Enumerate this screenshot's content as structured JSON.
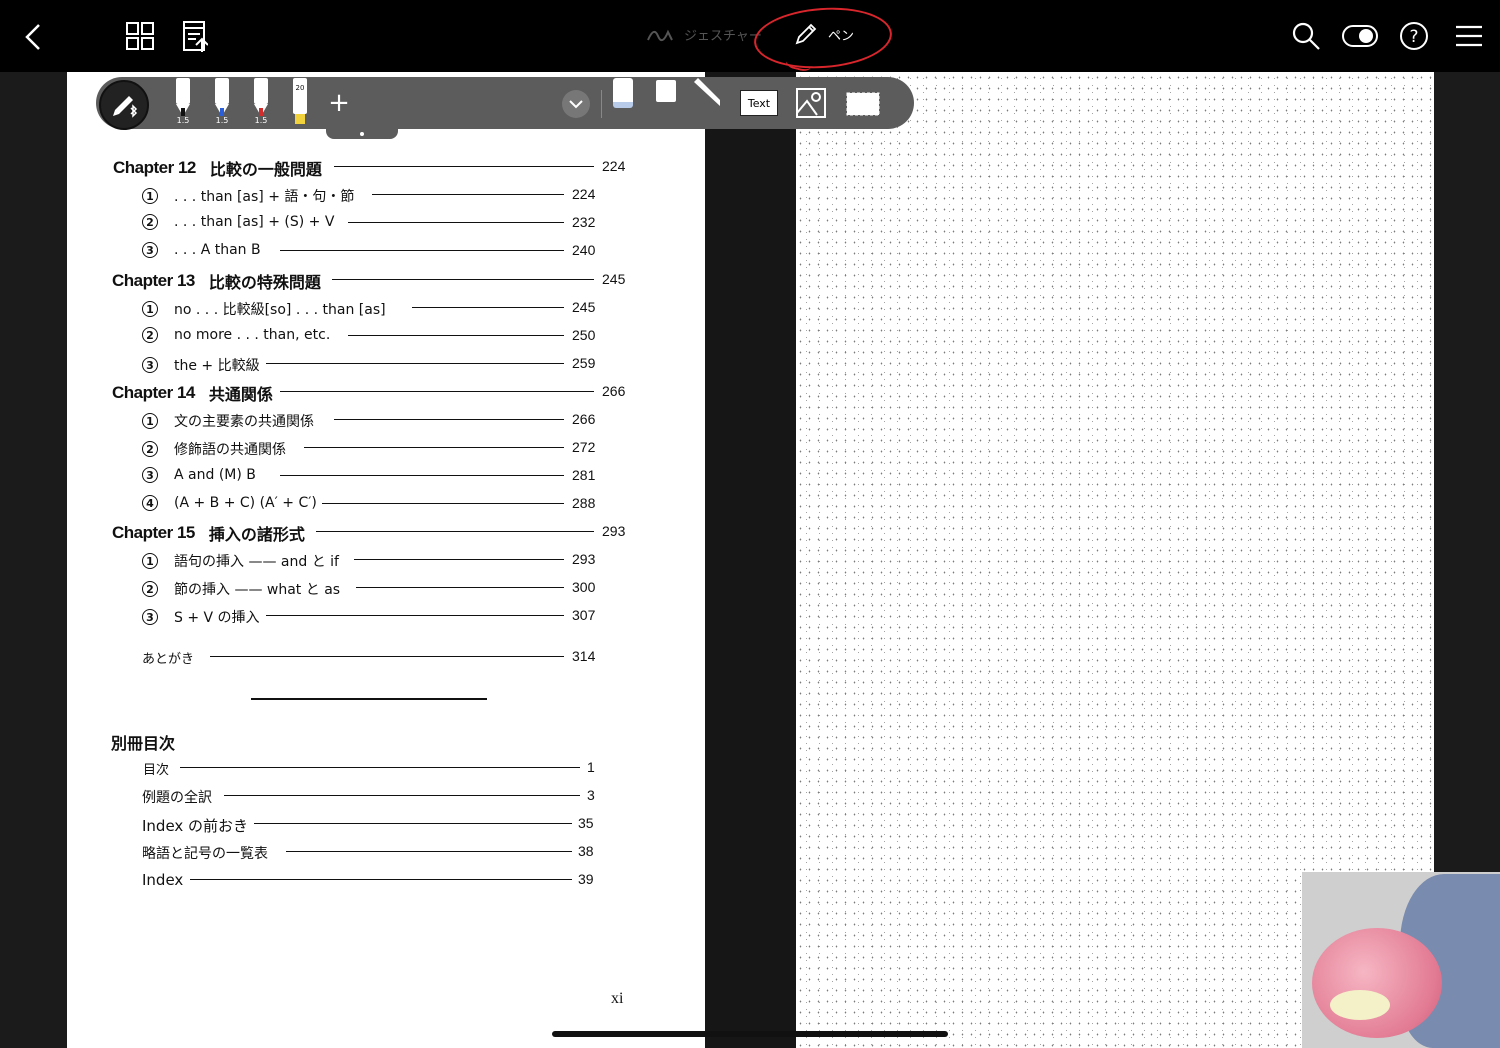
{
  "topbar": {
    "back_icon": "chevron-left-icon",
    "grid_icon": "grid-icon",
    "export_icon": "export-icon",
    "modes": {
      "gesture": "ジェスチャー",
      "pen": "ペン"
    },
    "right_icons": [
      "search-icon",
      "toggle-icon",
      "help-icon",
      "menu-icon"
    ],
    "help_glyph": "?"
  },
  "toolbar": {
    "tools": [
      {
        "name": "pen-tool-black",
        "color": "#111111",
        "size": "1.5"
      },
      {
        "name": "pen-tool-blue",
        "color": "#2b5fd9",
        "size": "1.5"
      },
      {
        "name": "pen-tool-red",
        "color": "#d42b2b",
        "size": "1.5"
      },
      {
        "name": "highlighter-yellow",
        "color": "#f2d23c",
        "size": "20"
      }
    ],
    "add_glyph": "+",
    "text_tool_label": "Text"
  },
  "toc": {
    "chapters": [
      {
        "number": "Chapter 12",
        "title": "比較の一般問題",
        "page": "224",
        "sections": [
          {
            "num": "1",
            "title": ". . . than [as] + 語・句・節",
            "page": "224"
          },
          {
            "num": "2",
            "title": ". . . than [as] + (S) + V",
            "page": "232"
          },
          {
            "num": "3",
            "title": ". . . A than B",
            "page": "240"
          }
        ]
      },
      {
        "number": "Chapter 13",
        "title": "比較の特殊問題",
        "page": "245",
        "sections": [
          {
            "num": "1",
            "title": "no . . . 比較級[so] . . . than [as]",
            "page": "245"
          },
          {
            "num": "2",
            "title": "no more . . . than, etc.",
            "page": "250"
          },
          {
            "num": "3",
            "title": "the + 比較級",
            "page": "259"
          }
        ]
      },
      {
        "number": "Chapter 14",
        "title": "共通関係",
        "page": "266",
        "sections": [
          {
            "num": "1",
            "title": "文の主要素の共通関係",
            "page": "266"
          },
          {
            "num": "2",
            "title": "修飾語の共通関係",
            "page": "272"
          },
          {
            "num": "3",
            "title": "A and (M) B",
            "page": "281"
          },
          {
            "num": "4",
            "title": "(A + B + C) (A′ + C′)",
            "page": "288"
          }
        ]
      },
      {
        "number": "Chapter 15",
        "title": "挿入の諸形式",
        "page": "293",
        "sections": [
          {
            "num": "1",
            "title": "語句の挿入 —— and と if",
            "page": "293"
          },
          {
            "num": "2",
            "title": "節の挿入 —— what と as",
            "page": "300"
          },
          {
            "num": "3",
            "title": "S + V の挿入",
            "page": "307"
          }
        ]
      }
    ],
    "afterword": {
      "title": "あとがき",
      "page": "314"
    },
    "bessatsu_heading": "別冊目次",
    "bessatsu": [
      {
        "title": "目次",
        "page": "1"
      },
      {
        "title": "例題の全訳",
        "page": "3"
      },
      {
        "title": "Index の前おき",
        "page": "35"
      },
      {
        "title": "略語と記号の一覧表",
        "page": "38"
      },
      {
        "title": "Index",
        "page": "39"
      }
    ],
    "folio": "xi"
  },
  "colors": {
    "annotation_red": "#d8262c",
    "toolbar_bg": "#5c5c5c",
    "topbar_bg": "#000000"
  }
}
